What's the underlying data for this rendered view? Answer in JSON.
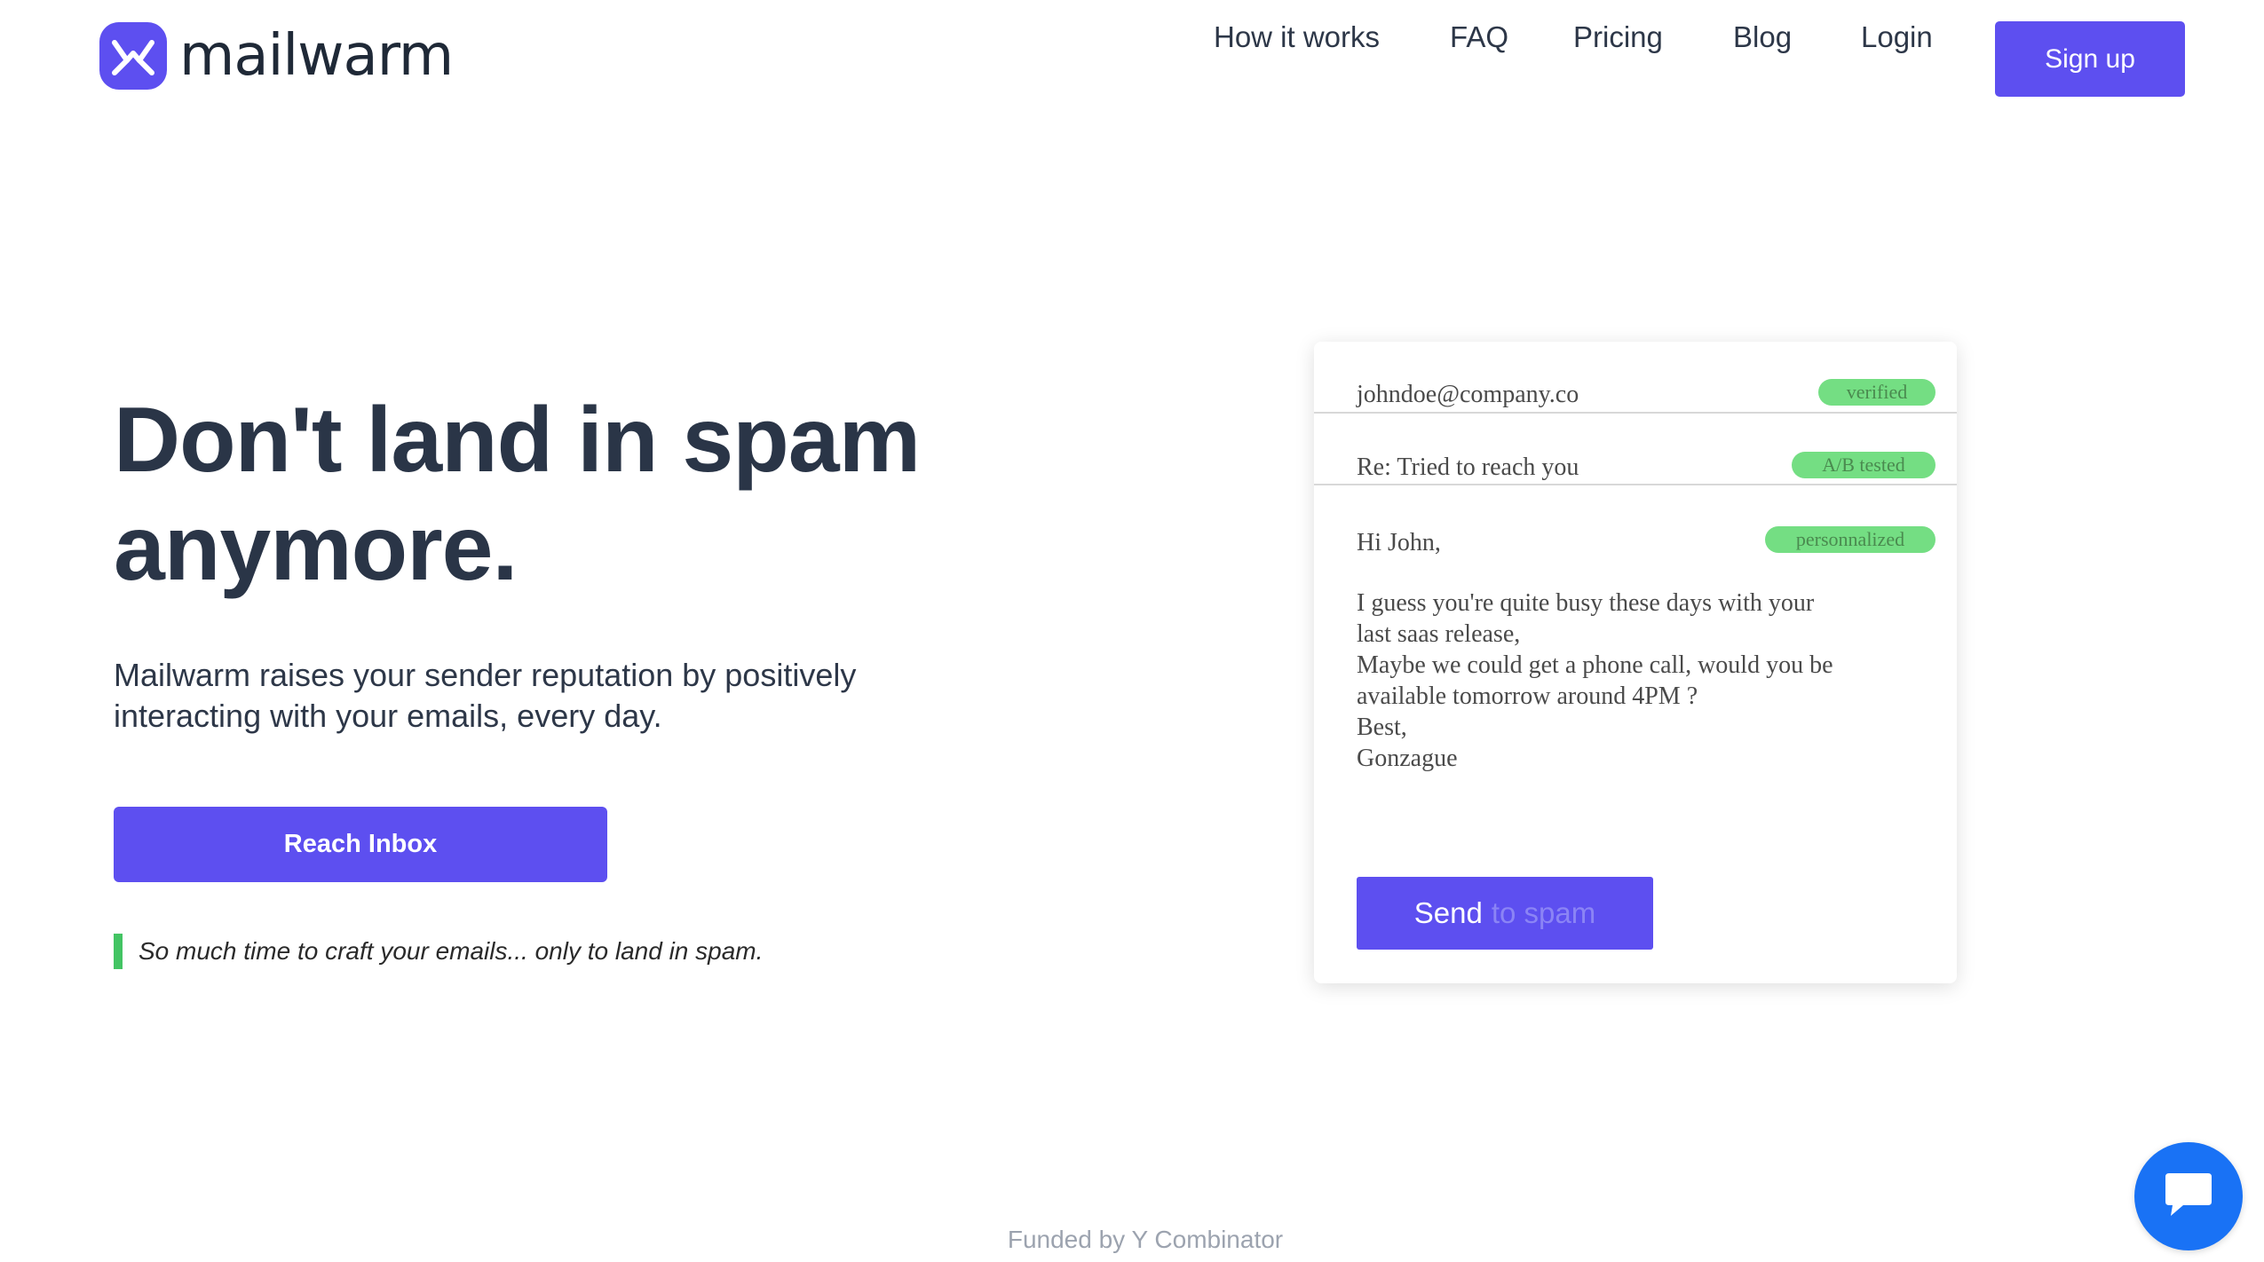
{
  "brand": {
    "name": "mailwarm",
    "accent_color": "#5d4ff0",
    "logo_icon": "envelope-check-icon"
  },
  "nav": {
    "items": [
      {
        "label": "How it works"
      },
      {
        "label": "FAQ"
      },
      {
        "label": "Pricing"
      },
      {
        "label": "Blog"
      },
      {
        "label": "Login"
      }
    ],
    "signup_label": "Sign up"
  },
  "hero": {
    "title": "Don't land in spam anymore.",
    "subtitle": "Mailwarm raises your sender reputation by positively interacting  with your emails, every day.",
    "cta_label": "Reach Inbox",
    "quote": "So much time to craft your emails... only to land in spam.",
    "quote_bar_color": "#43c463"
  },
  "email_card": {
    "to": {
      "value": "johndoe@company.co",
      "badge": "verified"
    },
    "subject": {
      "value": "Re: Tried to reach you",
      "badge": "A/B tested"
    },
    "greeting": {
      "value": "Hi John,",
      "badge": "personnalized"
    },
    "body_lines": [
      "I guess you're quite busy these days with your",
      "last saas release,",
      "Maybe we could get a phone call, would you be",
      "available tomorrow around 4PM ?",
      "Best,",
      "Gonzague"
    ],
    "send_label": "Send",
    "send_faded_label": "to spam",
    "badge_color": "#74de83"
  },
  "footer": {
    "funded_text": "Funded by Y Combinator"
  },
  "chat": {
    "icon": "chat-bubble-icon",
    "color": "#1972f5"
  }
}
